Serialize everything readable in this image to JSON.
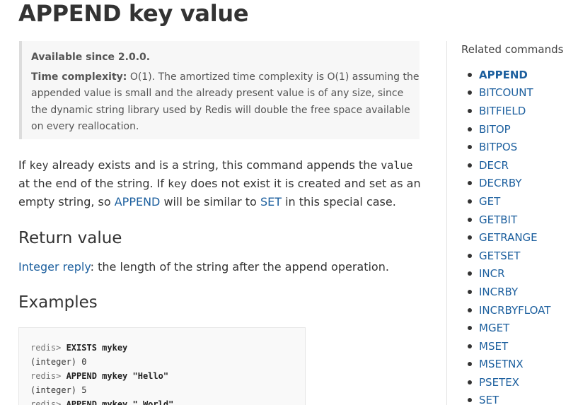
{
  "title": "APPEND key value",
  "meta": {
    "since": "Available since 2.0.0.",
    "complexity_label": "Time complexity:",
    "complexity_text": " O(1). The amortized time complexity is O(1) assuming the appended value is small and the already present value is of any size, since the dynamic string library used by Redis will double the free space available on every reallocation."
  },
  "description": {
    "t1": "If ",
    "key1": "key",
    "t2": " already exists and is a string, this command appends the ",
    "value1": "value",
    "t3": " at the end of the string. If ",
    "key2": "key",
    "t4": " does not exist it is created and set as an empty string, so ",
    "link_append": "APPEND",
    "t5": " will be similar to ",
    "link_set": "SET",
    "t6": " in this special case."
  },
  "return_value": {
    "heading": "Return value",
    "link": "Integer reply",
    "text": ": the length of the string after the append operation."
  },
  "examples": {
    "heading": "Examples",
    "lines": [
      {
        "prompt": "redis> ",
        "cmd": "EXISTS mykey",
        "arg": ""
      },
      {
        "out": "(integer) 0"
      },
      {
        "prompt": "redis> ",
        "cmd": "APPEND mykey ",
        "arg": "\"Hello\""
      },
      {
        "out": "(integer) 5"
      },
      {
        "prompt": "redis> ",
        "cmd": "APPEND mykey ",
        "arg": "\" World\""
      }
    ]
  },
  "sidebar": {
    "title": "Related commands",
    "items": [
      {
        "label": "APPEND",
        "current": true
      },
      {
        "label": "BITCOUNT"
      },
      {
        "label": "BITFIELD"
      },
      {
        "label": "BITOP"
      },
      {
        "label": "BITPOS"
      },
      {
        "label": "DECR"
      },
      {
        "label": "DECRBY"
      },
      {
        "label": "GET"
      },
      {
        "label": "GETBIT"
      },
      {
        "label": "GETRANGE"
      },
      {
        "label": "GETSET"
      },
      {
        "label": "INCR"
      },
      {
        "label": "INCRBY"
      },
      {
        "label": "INCRBYFLOAT"
      },
      {
        "label": "MGET"
      },
      {
        "label": "MSET"
      },
      {
        "label": "MSETNX"
      },
      {
        "label": "PSETEX"
      },
      {
        "label": "SET"
      }
    ]
  },
  "colors": {
    "link": "#1c5f9e",
    "meta_background": "#f7f7f7",
    "meta_border": "#dcdcdc",
    "text": "#333333"
  }
}
